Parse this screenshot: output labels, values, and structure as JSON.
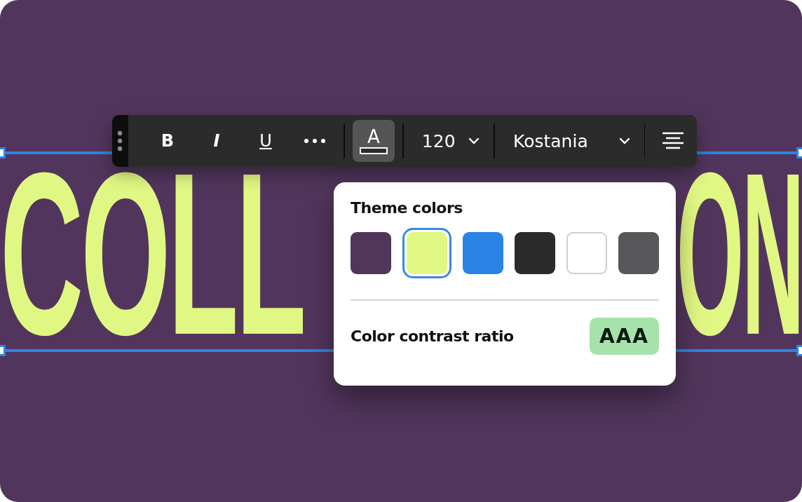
{
  "canvas": {
    "heading_parts": [
      "COLL",
      "ON"
    ]
  },
  "toolbar": {
    "tools": [
      {
        "kind": "bold",
        "label": "B",
        "selected": false
      },
      {
        "kind": "italic",
        "label": "I",
        "selected": false
      },
      {
        "kind": "underline",
        "label": "U",
        "selected": false
      },
      {
        "kind": "more",
        "selected": false
      },
      {
        "kind": "text-color",
        "label": "A",
        "selected": true
      }
    ],
    "font_size": "120",
    "font_family": "Kostania"
  },
  "popover": {
    "title": "Theme colors",
    "swatches": [
      {
        "color": "#51355b",
        "selected": false
      },
      {
        "color": "#e1f783",
        "selected": true
      },
      {
        "color": "#2a84e6",
        "selected": false
      },
      {
        "color": "#2b2b2b",
        "selected": false
      },
      {
        "color": "#ffffff",
        "selected": false
      },
      {
        "color": "#58585a",
        "selected": false
      }
    ],
    "contrast_label": "Color contrast ratio",
    "contrast_badge": "AAA"
  }
}
